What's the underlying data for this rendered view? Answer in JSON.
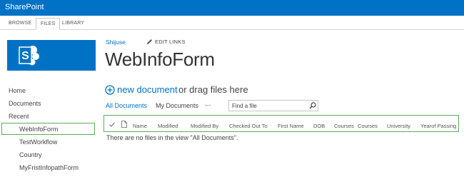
{
  "suite_bar": {
    "title": "SharePoint"
  },
  "ribbon": {
    "tabs": [
      "BROWSE",
      "FILES",
      "LIBRARY"
    ]
  },
  "site": {
    "name": "Shijuse",
    "edit_links": "EDIT LINKS",
    "title": "WebInfoForm"
  },
  "nav": {
    "items": [
      "Home",
      "Documents",
      "Recent"
    ],
    "recent": [
      "WebInfoForm",
      "TestWorkflow",
      "Country",
      "MyFristInfopathForm"
    ]
  },
  "library": {
    "new_document": "new document",
    "drag_text": "or drag files here",
    "views": [
      "All Documents",
      "My Documents"
    ],
    "more": "...",
    "search_placeholder": "Find a file",
    "columns": [
      "Name",
      "Modified",
      "Modified By",
      "Checked Out To",
      "First Name",
      "DOB",
      "Courses",
      "Courses",
      "University",
      "Yearof Passing"
    ],
    "empty_message": "There are no files in the view \"All Documents\"."
  },
  "colors": {
    "brand": "#0072c6",
    "highlight": "#5cad5c"
  },
  "icons": [
    "sharepoint-logo-icon",
    "pencil-icon",
    "plus-circle-icon",
    "search-icon",
    "checkmark-icon",
    "document-icon"
  ]
}
